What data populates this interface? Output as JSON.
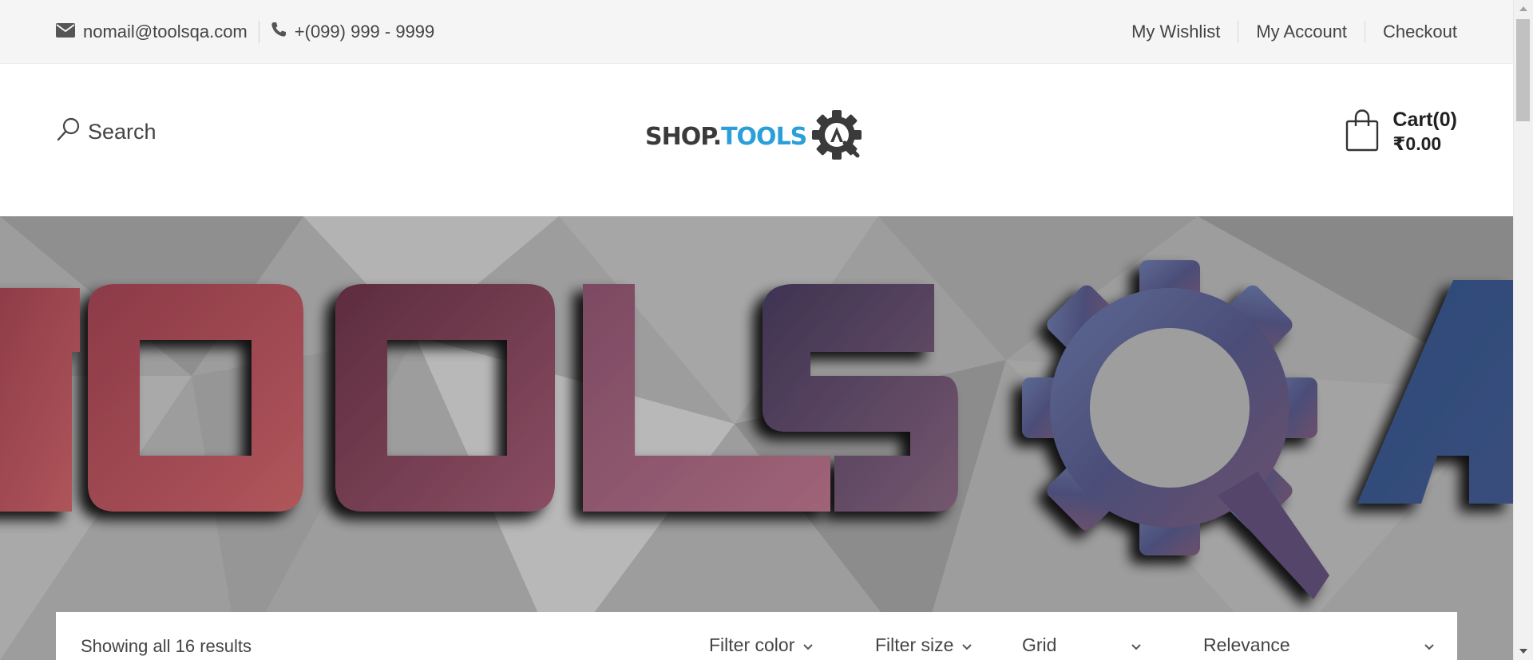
{
  "topbar": {
    "email": "nomail@toolsqa.com",
    "phone": "+(099) 999 - 9999",
    "links": [
      "My Wishlist",
      "My Account",
      "Checkout"
    ]
  },
  "header": {
    "search_label": "Search",
    "logo_shop": "SHOP.",
    "logo_tools": "TOOLS",
    "cart_label": "Cart(0)",
    "cart_total": "₹0.00"
  },
  "banner": {
    "text": "TOOLSQA"
  },
  "toolbar": {
    "results_text": "Showing all 16 results",
    "filter_color": "Filter color",
    "filter_size": "Filter size",
    "view_mode": "Grid",
    "sort_by": "Relevance"
  },
  "icons": {
    "email": "envelope-icon",
    "phone": "phone-icon",
    "search": "magnifier-icon",
    "cart": "shopping-bag-icon"
  },
  "colors": {
    "logo_shop": "#3a3a3a",
    "logo_tools": "#2a9fd8",
    "topbar_bg": "#f5f5f5"
  }
}
